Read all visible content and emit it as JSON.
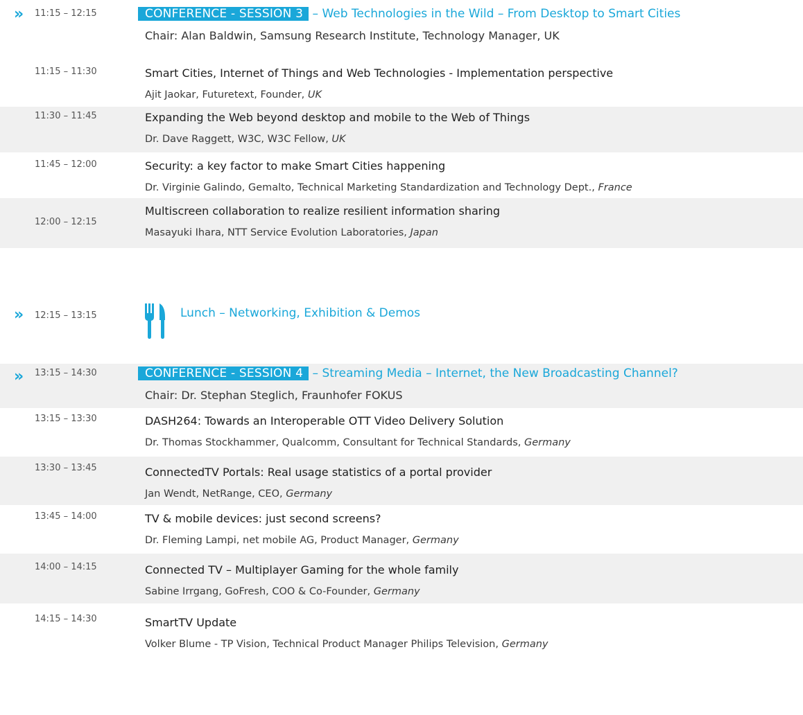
{
  "session3": {
    "time": "11:15 – 12:15",
    "badge": "CONFERENCE - SESSION 3",
    "title": " – Web Technologies in the Wild – From Desktop to Smart Cities",
    "chair": "Chair: Alan Baldwin, Samsung Research Institute, Technology Manager, UK",
    "talks": [
      {
        "time": "11:15 – 11:30",
        "title": "Smart Cities, Internet of Things and Web Technologies - Implementation perspective",
        "speaker": "Ajit Jaokar, Futuretext, Founder, ",
        "country": "UK"
      },
      {
        "time": "11:30 – 11:45",
        "title": "Expanding the Web beyond desktop and mobile to the Web of Things",
        "speaker": "Dr. Dave Raggett, W3C, W3C Fellow, ",
        "country": "UK"
      },
      {
        "time": "11:45 – 12:00",
        "title": "Security: a key factor to make Smart Cities happening",
        "speaker": "Dr. Virginie Galindo, Gemalto, Technical Marketing Standardization and Technology Dept., ",
        "country": "France"
      },
      {
        "time": "12:00 – 12:15",
        "title": "Multiscreen collaboration to realize resilient information sharing",
        "speaker": "Masayuki Ihara, NTT Service Evolution Laboratories, ",
        "country": "Japan"
      }
    ]
  },
  "lunch": {
    "time": "12:15 – 13:15",
    "label": "Lunch – Networking, Exhibition & Demos"
  },
  "session4": {
    "time": "13:15 – 14:30",
    "badge": "CONFERENCE - SESSION 4",
    "title": " – Streaming Media – Internet, the New Broadcasting Channel?",
    "chair": "Chair: Dr. Stephan Steglich, Fraunhofer FOKUS",
    "talks": [
      {
        "time": "13:15 – 13:30",
        "title": "DASH264: Towards an Interoperable OTT Video Delivery Solution",
        "speaker": "Dr. Thomas Stockhammer, Qualcomm, Consultant for Technical Standards, ",
        "country": "Germany"
      },
      {
        "time": "13:30 – 13:45",
        "title": "ConnectedTV Portals: Real usage statistics of a portal provider",
        "speaker": "Jan Wendt, NetRange, CEO, ",
        "country": "Germany"
      },
      {
        "time": "13:45 – 14:00",
        "title": "TV & mobile devices: just second screens?",
        "speaker": "Dr. Fleming Lampi, net mobile AG, Product Manager, ",
        "country": "Germany"
      },
      {
        "time": "14:00 – 14:15",
        "title": "Connected TV – Multiplayer Gaming for the whole family",
        "speaker": "Sabine Irrgang, GoFresh, COO & Co-Founder, ",
        "country": "Germany"
      },
      {
        "time": "14:15 – 14:30",
        "title": "SmartTV Update",
        "speaker": "Volker Blume - TP Vision, Technical Product Manager Philips Television, ",
        "country": "Germany"
      }
    ]
  },
  "accent_color": "#1aa7d9",
  "shade_color": "#f0f0f0"
}
